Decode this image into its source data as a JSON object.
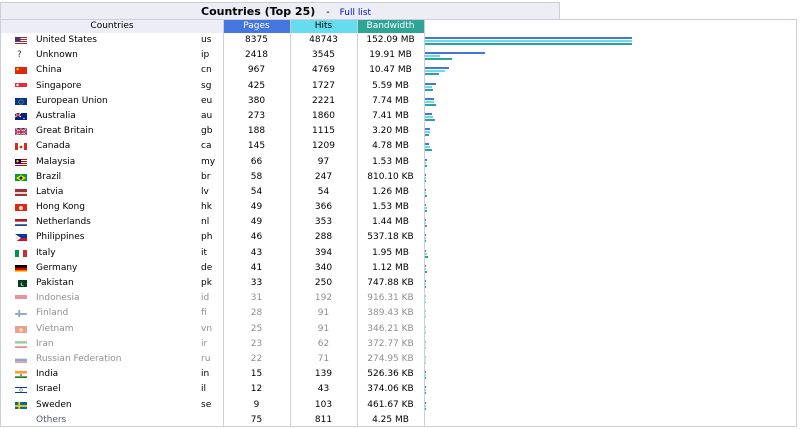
{
  "header": {
    "title": "Countries (Top 25)",
    "separator": "-",
    "full_list_link": "Full list"
  },
  "columns": {
    "countries": "Countries",
    "pages": "Pages",
    "hits": "Hits",
    "bandwidth": "Bandwidth"
  },
  "colors": {
    "pages": "#4477dd",
    "hits": "#66ddee",
    "bandwidth": "#2ea495"
  },
  "rows": [
    {
      "name": "United States",
      "code": "us",
      "pages": "8375",
      "hits": "48743",
      "bandwidth": "152.09 MB",
      "faded": false,
      "flag": "us"
    },
    {
      "name": "Unknown",
      "code": "ip",
      "pages": "2418",
      "hits": "3545",
      "bandwidth": "19.91 MB",
      "faded": false,
      "flag": "unknown"
    },
    {
      "name": "China",
      "code": "cn",
      "pages": "967",
      "hits": "4769",
      "bandwidth": "10.47 MB",
      "faded": false,
      "flag": "cn"
    },
    {
      "name": "Singapore",
      "code": "sg",
      "pages": "425",
      "hits": "1727",
      "bandwidth": "5.59 MB",
      "faded": false,
      "flag": "sg"
    },
    {
      "name": "European Union",
      "code": "eu",
      "pages": "380",
      "hits": "2221",
      "bandwidth": "7.74 MB",
      "faded": false,
      "flag": "eu"
    },
    {
      "name": "Australia",
      "code": "au",
      "pages": "273",
      "hits": "1860",
      "bandwidth": "7.41 MB",
      "faded": false,
      "flag": "au"
    },
    {
      "name": "Great Britain",
      "code": "gb",
      "pages": "188",
      "hits": "1115",
      "bandwidth": "3.20 MB",
      "faded": false,
      "flag": "gb"
    },
    {
      "name": "Canada",
      "code": "ca",
      "pages": "145",
      "hits": "1209",
      "bandwidth": "4.78 MB",
      "faded": false,
      "flag": "ca"
    },
    {
      "name": "Malaysia",
      "code": "my",
      "pages": "66",
      "hits": "97",
      "bandwidth": "1.53 MB",
      "faded": false,
      "flag": "my"
    },
    {
      "name": "Brazil",
      "code": "br",
      "pages": "58",
      "hits": "247",
      "bandwidth": "810.10 KB",
      "faded": false,
      "flag": "br"
    },
    {
      "name": "Latvia",
      "code": "lv",
      "pages": "54",
      "hits": "54",
      "bandwidth": "1.26 MB",
      "faded": false,
      "flag": "lv"
    },
    {
      "name": "Hong Kong",
      "code": "hk",
      "pages": "49",
      "hits": "366",
      "bandwidth": "1.53 MB",
      "faded": false,
      "flag": "hk"
    },
    {
      "name": "Netherlands",
      "code": "nl",
      "pages": "49",
      "hits": "353",
      "bandwidth": "1.44 MB",
      "faded": false,
      "flag": "nl"
    },
    {
      "name": "Philippines",
      "code": "ph",
      "pages": "46",
      "hits": "288",
      "bandwidth": "537.18 KB",
      "faded": false,
      "flag": "ph"
    },
    {
      "name": "Italy",
      "code": "it",
      "pages": "43",
      "hits": "394",
      "bandwidth": "1.95 MB",
      "faded": false,
      "flag": "it"
    },
    {
      "name": "Germany",
      "code": "de",
      "pages": "41",
      "hits": "340",
      "bandwidth": "1.12 MB",
      "faded": false,
      "flag": "de"
    },
    {
      "name": "Pakistan",
      "code": "pk",
      "pages": "33",
      "hits": "250",
      "bandwidth": "747.88 KB",
      "faded": false,
      "flag": "pk"
    },
    {
      "name": "Indonesia",
      "code": "id",
      "pages": "31",
      "hits": "192",
      "bandwidth": "916.31 KB",
      "faded": true,
      "flag": "id"
    },
    {
      "name": "Finland",
      "code": "fi",
      "pages": "28",
      "hits": "91",
      "bandwidth": "389.43 KB",
      "faded": true,
      "flag": "fi"
    },
    {
      "name": "Vietnam",
      "code": "vn",
      "pages": "25",
      "hits": "91",
      "bandwidth": "346.21 KB",
      "faded": true,
      "flag": "vn"
    },
    {
      "name": "Iran",
      "code": "ir",
      "pages": "23",
      "hits": "62",
      "bandwidth": "372.77 KB",
      "faded": true,
      "flag": "ir"
    },
    {
      "name": "Russian Federation",
      "code": "ru",
      "pages": "22",
      "hits": "71",
      "bandwidth": "274.95 KB",
      "faded": true,
      "flag": "ru"
    },
    {
      "name": "India",
      "code": "in",
      "pages": "15",
      "hits": "139",
      "bandwidth": "526.36 KB",
      "faded": false,
      "flag": "in"
    },
    {
      "name": "Israel",
      "code": "il",
      "pages": "12",
      "hits": "43",
      "bandwidth": "374.06 KB",
      "faded": false,
      "flag": "il"
    },
    {
      "name": "Sweden",
      "code": "se",
      "pages": "9",
      "hits": "103",
      "bandwidth": "461.67 KB",
      "faded": false,
      "flag": "se"
    }
  ],
  "others": {
    "label": "Others",
    "pages": "75",
    "hits": "811",
    "bandwidth": "4.25 MB"
  }
}
